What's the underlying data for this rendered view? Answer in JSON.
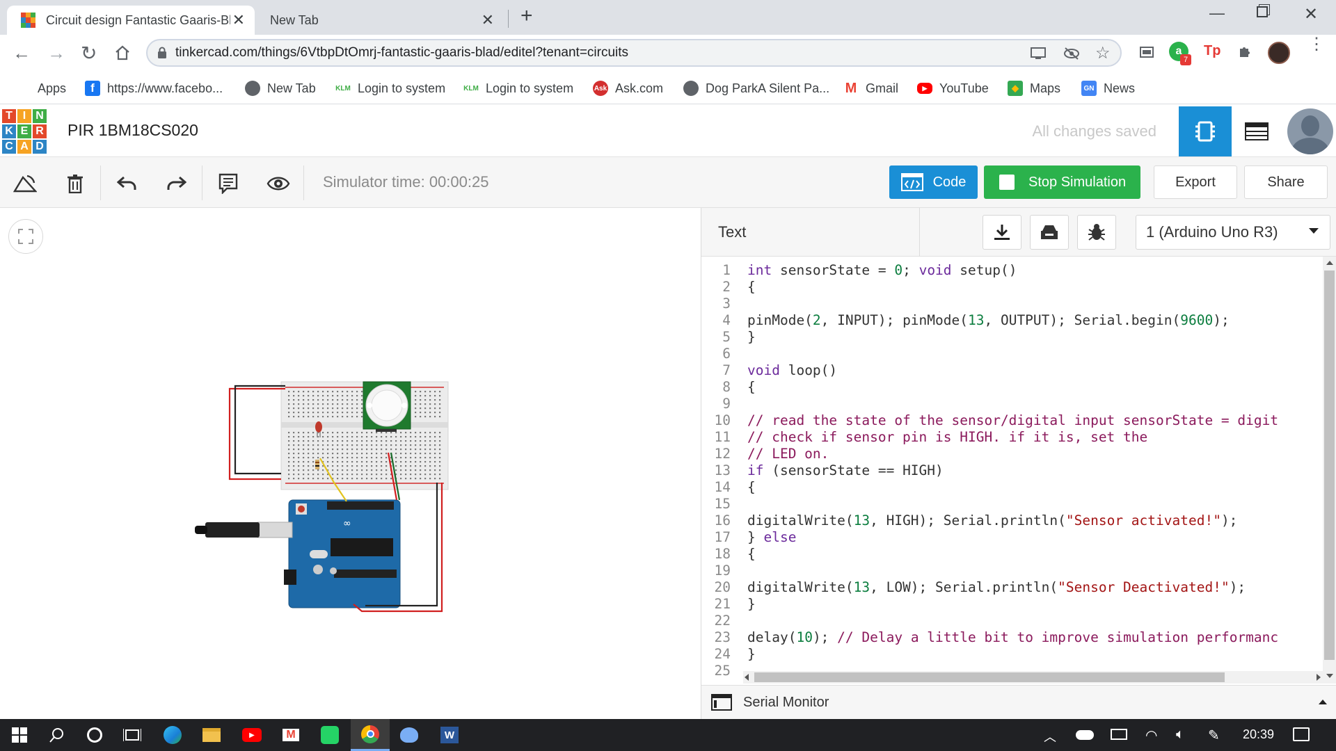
{
  "browser": {
    "tabs": [
      {
        "title": "Circuit design Fantastic Gaaris-Bl",
        "active": true
      },
      {
        "title": "New Tab",
        "active": false
      }
    ],
    "new_tab_glyph": "+",
    "url": "tinkercad.com/things/6VtbpDtOmrj-fantastic-gaaris-blad/editel?tenant=circuits",
    "extension_badge": "7",
    "bookmarks": [
      {
        "label": "Apps",
        "icon": "apps-grid-icon"
      },
      {
        "label": "https://www.facebo...",
        "icon": "facebook-icon"
      },
      {
        "label": "New Tab",
        "icon": "globe-icon"
      },
      {
        "label": "Login to system",
        "icon": "login-icon"
      },
      {
        "label": "Login to system",
        "icon": "login-icon"
      },
      {
        "label": "Ask.com",
        "icon": "ask-icon"
      },
      {
        "label": "Dog ParkA Silent Pa...",
        "icon": "globe-icon"
      },
      {
        "label": "Gmail",
        "icon": "gmail-icon"
      },
      {
        "label": "YouTube",
        "icon": "youtube-icon"
      },
      {
        "label": "Maps",
        "icon": "maps-icon"
      },
      {
        "label": "News",
        "icon": "news-icon"
      }
    ]
  },
  "app": {
    "logo_letters": [
      "T",
      "I",
      "N",
      "K",
      "E",
      "R",
      "C",
      "A",
      "D"
    ],
    "project_title": "PIR 1BM18CS020",
    "save_status": "All changes saved",
    "simulator_time": "Simulator time: 00:00:25",
    "code_button": "Code",
    "stop_button": "Stop Simulation",
    "export_button": "Export",
    "share_button": "Share",
    "colors": {
      "blue": "#1a8fd6",
      "green": "#2bb24c",
      "logo_red": "#e3492b",
      "logo_orange": "#f6a323",
      "logo_green": "#3fad46",
      "logo_blue": "#2d85c5"
    }
  },
  "code_panel": {
    "mode": "Text",
    "device": "1 (Arduino Uno R3)",
    "serial_monitor": "Serial Monitor",
    "lines": [
      [
        [
          "kw",
          "int"
        ],
        [
          "t",
          " sensorState = "
        ],
        [
          "num",
          "0"
        ],
        [
          "t",
          "; "
        ],
        [
          "kw",
          "void"
        ],
        [
          "t",
          " setup()"
        ]
      ],
      [
        [
          "t",
          "{"
        ]
      ],
      [],
      [
        [
          "t",
          "pinMode("
        ],
        [
          "num",
          "2"
        ],
        [
          "t",
          ", INPUT); pinMode("
        ],
        [
          "num",
          "13"
        ],
        [
          "t",
          ", OUTPUT); Serial.begin("
        ],
        [
          "num",
          "9600"
        ],
        [
          "t",
          ");"
        ]
      ],
      [
        [
          "t",
          "}"
        ]
      ],
      [],
      [
        [
          "kw",
          "void"
        ],
        [
          "t",
          " loop()"
        ]
      ],
      [
        [
          "t",
          "{"
        ]
      ],
      [],
      [
        [
          "cm",
          "// read the state of the sensor/digital input sensorState = digit"
        ]
      ],
      [
        [
          "cm",
          "// check if sensor pin is HIGH. if it is, set the"
        ]
      ],
      [
        [
          "cm",
          "// LED on."
        ]
      ],
      [
        [
          "kw",
          "if"
        ],
        [
          "t",
          " (sensorState == HIGH)"
        ]
      ],
      [
        [
          "t",
          "{"
        ]
      ],
      [],
      [
        [
          "t",
          "digitalWrite("
        ],
        [
          "num",
          "13"
        ],
        [
          "t",
          ", HIGH); Serial.println("
        ],
        [
          "str",
          "\"Sensor activated!\""
        ],
        [
          "t",
          ");"
        ]
      ],
      [
        [
          "t",
          "} "
        ],
        [
          "kw",
          "else"
        ]
      ],
      [
        [
          "t",
          "{"
        ]
      ],
      [],
      [
        [
          "t",
          "digitalWrite("
        ],
        [
          "num",
          "13"
        ],
        [
          "t",
          ", LOW); Serial.println("
        ],
        [
          "str",
          "\"Sensor Deactivated!\""
        ],
        [
          "t",
          ");"
        ]
      ],
      [
        [
          "t",
          "}"
        ]
      ],
      [],
      [
        [
          "t",
          "delay("
        ],
        [
          "num",
          "10"
        ],
        [
          "t",
          "); "
        ],
        [
          "cm",
          "// Delay a little bit to improve simulation performanc"
        ]
      ],
      [
        [
          "t",
          "}"
        ]
      ],
      []
    ]
  },
  "taskbar": {
    "time": "20:39"
  }
}
